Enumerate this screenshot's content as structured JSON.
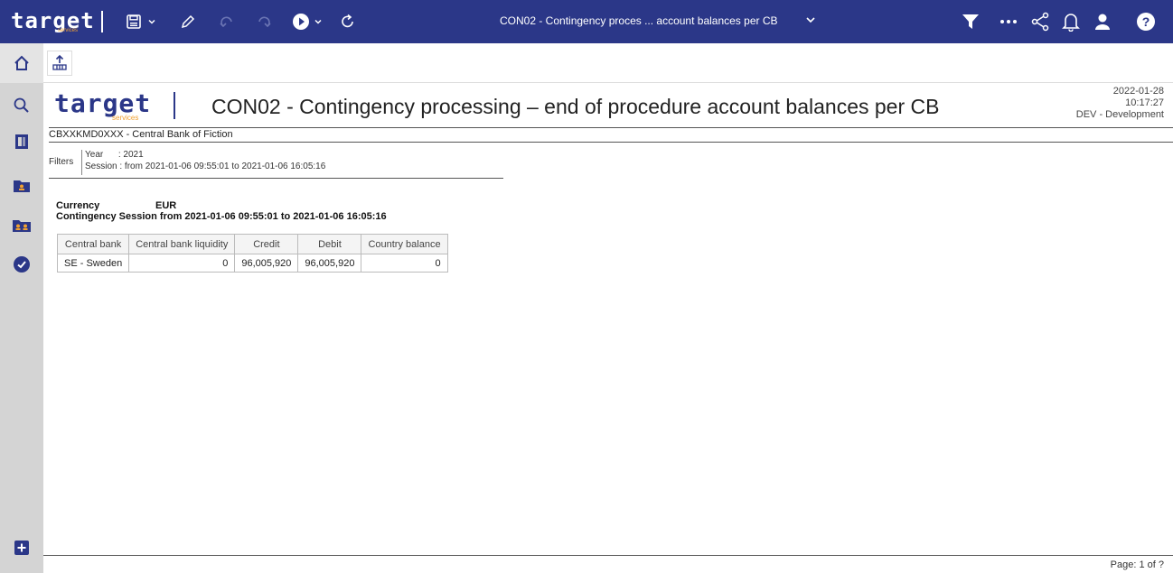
{
  "topbar": {
    "logo_text": "target",
    "logo_sub": "services",
    "title": "CON02 - Contingency proces ... account balances per CB",
    "icons": [
      "save-icon",
      "chevron-down-icon",
      "edit-icon",
      "undo-icon",
      "redo-icon",
      "play-icon",
      "chevron-down-icon",
      "refresh-icon",
      "filter-icon",
      "more-icon",
      "share-icon",
      "bell-icon",
      "user-icon",
      "help-icon"
    ],
    "background": "#2b3788"
  },
  "sidebar": {
    "icons": [
      "home-icon",
      "search-icon",
      "documents-icon",
      "folder-icon",
      "folders-icon",
      "check-circle-icon",
      "add-icon"
    ]
  },
  "toolbar": {
    "export_icon": "export-icon"
  },
  "report": {
    "logo_text": "target",
    "logo_sub": "services",
    "title": "CON02 - Contingency processing – end of procedure account balances per CB",
    "date": "2022-01-28",
    "time": "10:17:27",
    "environment": "DEV - Development",
    "bank": "CBXXKMD0XXX - Central Bank of Fiction",
    "filters_label": "Filters",
    "filter_year": "Year      : 2021",
    "filter_session": "Session : from 2021-01-06 09:55:01 to 2021-01-06 16:05:16",
    "currency_label": "Currency",
    "currency_value": "EUR",
    "session_line": "Contingency Session from 2021-01-06 09:55:01 to 2021-01-06 16:05:16",
    "table": {
      "headers": [
        "Central bank",
        "Central bank liquidity",
        "Credit",
        "Debit",
        "Country balance"
      ],
      "rows": [
        [
          "SE - Sweden",
          "0",
          "96,005,920",
          "96,005,920",
          "0"
        ]
      ]
    },
    "page_info": "Page:  1 of ?"
  }
}
